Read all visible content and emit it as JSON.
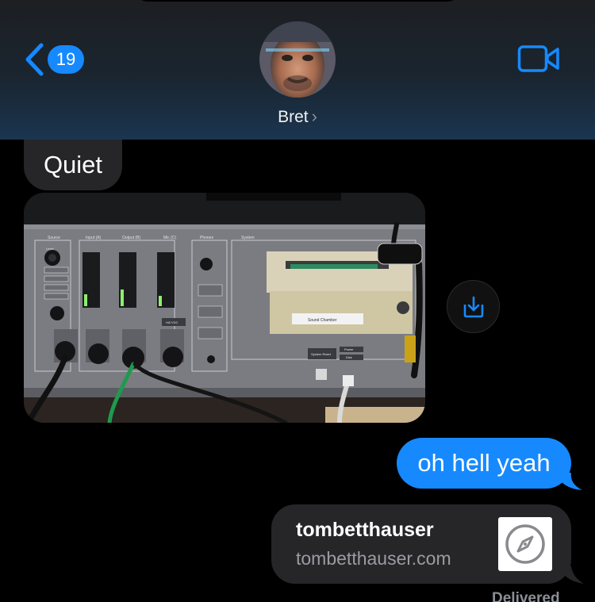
{
  "header": {
    "back_badge_count": "19",
    "contact_name": "Bret",
    "contact_chevron": "›"
  },
  "messages": {
    "incoming_text": "Quiet",
    "outgoing_text": "oh hell yeah",
    "link_preview": {
      "title": "tombetthauser",
      "domain": "tombetthauser.com"
    },
    "status": "Delivered"
  },
  "photo": {
    "panel_labels": [
      "Source",
      "Input (A)",
      "Output (B)",
      "Mic (C)",
      "Phones",
      "System",
      "+48 VDC",
      "Sound Chamber",
      "System Reset",
      "Power",
      "Disk",
      "Level"
    ]
  },
  "icons": {
    "back": "chevron-left-icon",
    "video": "video-camera-icon",
    "save": "save-download-icon",
    "compass": "safari-compass-icon"
  },
  "colors": {
    "accent": "#1689ff",
    "incoming_bubble": "#262629",
    "background": "#000000"
  }
}
